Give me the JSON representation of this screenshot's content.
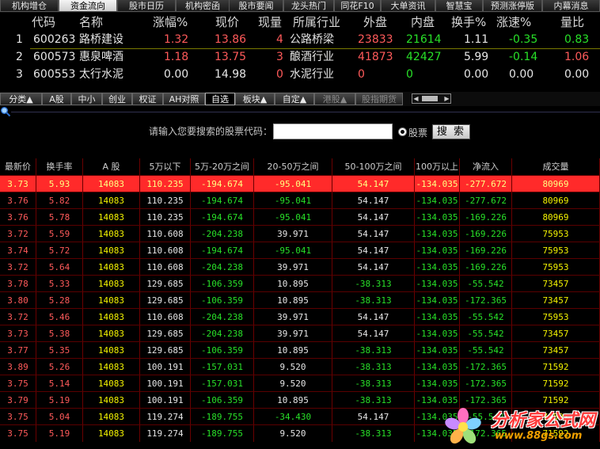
{
  "top_tabs": [
    "机构增仓",
    "资金流向",
    "股市日历",
    "机构密函",
    "股市要闻",
    "龙头热门",
    "同花F10",
    "大单资讯",
    "智慧宝",
    "预测涨停版",
    "内幕消息"
  ],
  "top_tabs_active": 1,
  "quote": {
    "headers": [
      "代码",
      "名称",
      "涨幅%",
      "现价",
      "现量",
      "所属行业",
      "外盘",
      "内盘",
      "换手%",
      "涨速%",
      "量比"
    ],
    "rows": [
      {
        "idx": "1",
        "code": "600263",
        "name": "路桥建设",
        "chg": "1.32",
        "price": "13.86",
        "vol": "4",
        "industry": "公路桥梁",
        "outer": "23833",
        "inner": "21614",
        "turn": "1.11",
        "speed": "-0.35",
        "ratio": "0.83"
      },
      {
        "idx": "2",
        "code": "600573",
        "name": "惠泉啤酒",
        "chg": "1.18",
        "price": "13.75",
        "vol": "3",
        "industry": "酿酒行业",
        "outer": "41873",
        "inner": "42427",
        "turn": "5.99",
        "speed": "-0.14",
        "ratio": "1.06"
      },
      {
        "idx": "3",
        "code": "600553",
        "name": "太行水泥",
        "chg": "0.00",
        "price": "14.98",
        "vol": "0",
        "industry": "水泥行业",
        "outer": "0",
        "inner": "0",
        "turn": "0.00",
        "speed": "0.00",
        "ratio": "0.00"
      }
    ]
  },
  "board_tabs": [
    "分类▲",
    "A股",
    "中小",
    "创业",
    "权证",
    "AH对照",
    "自选",
    "板块▲",
    "自定▲",
    "港股▲",
    "股指期货"
  ],
  "board_tabs_active": 6,
  "search": {
    "prompt": "请输入您要搜索的股票代码：",
    "value": "",
    "radio_label": "股票",
    "button": "搜 索"
  },
  "table": {
    "headers": [
      "最新价",
      "换手率",
      "A 股",
      "5万以下",
      "5万-20万之间",
      "20-50万之间",
      "50-100万之间",
      "100万以上",
      "净流入",
      "成交量"
    ],
    "rows": [
      [
        "3.73",
        "5.93",
        "14083",
        "110.235",
        "-194.674",
        "-95.041",
        "54.147",
        "-134.035",
        "-277.672",
        "80969"
      ],
      [
        "3.76",
        "5.82",
        "14083",
        "110.235",
        "-194.674",
        "-95.041",
        "54.147",
        "-134.035",
        "-277.672",
        "80969"
      ],
      [
        "3.76",
        "5.78",
        "14083",
        "110.235",
        "-194.674",
        "-95.041",
        "54.147",
        "-134.035",
        "-169.226",
        "80969"
      ],
      [
        "3.72",
        "5.59",
        "14083",
        "110.608",
        "-204.238",
        "39.971",
        "54.147",
        "-134.035",
        "-169.226",
        "75953"
      ],
      [
        "3.74",
        "5.72",
        "14083",
        "110.608",
        "-194.674",
        "-95.041",
        "54.147",
        "-134.035",
        "-169.226",
        "75953"
      ],
      [
        "3.72",
        "5.64",
        "14083",
        "110.608",
        "-204.238",
        "39.971",
        "54.147",
        "-134.035",
        "-169.226",
        "75953"
      ],
      [
        "3.78",
        "5.33",
        "14083",
        "129.685",
        "-106.359",
        "10.895",
        "-38.313",
        "-134.035",
        "-55.542",
        "73457"
      ],
      [
        "3.80",
        "5.28",
        "14083",
        "129.685",
        "-106.359",
        "10.895",
        "-38.313",
        "-134.035",
        "-172.365",
        "73457"
      ],
      [
        "3.72",
        "5.46",
        "14083",
        "110.608",
        "-204.238",
        "39.971",
        "54.147",
        "-134.035",
        "-55.542",
        "75953"
      ],
      [
        "3.73",
        "5.38",
        "14083",
        "129.685",
        "-204.238",
        "39.971",
        "54.147",
        "-134.035",
        "-55.542",
        "73457"
      ],
      [
        "3.77",
        "5.35",
        "14083",
        "129.685",
        "-106.359",
        "10.895",
        "-38.313",
        "-134.035",
        "-55.542",
        "73457"
      ],
      [
        "3.89",
        "5.26",
        "14083",
        "100.191",
        "-157.031",
        "9.520",
        "-38.313",
        "-134.035",
        "-172.365",
        "71592"
      ],
      [
        "3.75",
        "5.14",
        "14083",
        "100.191",
        "-157.031",
        "9.520",
        "-38.313",
        "-134.035",
        "-172.365",
        "71592"
      ],
      [
        "3.79",
        "5.19",
        "14083",
        "100.191",
        "-106.359",
        "10.895",
        "-38.313",
        "-134.035",
        "-172.365",
        "71592"
      ],
      [
        "3.75",
        "5.04",
        "14083",
        "119.274",
        "-189.755",
        "-34.430",
        "54.147",
        "-134.035",
        "-55.542",
        "71592"
      ],
      [
        "3.75",
        "5.19",
        "14083",
        "119.274",
        "-189.755",
        "9.520",
        "-38.313",
        "-134.035",
        "-172.365",
        "71592"
      ]
    ]
  },
  "watermark": {
    "title": "分析家公式网",
    "url": "www.88gs.com"
  },
  "colors": {
    "up": "#ff5a5a",
    "down": "#28e028",
    "selected_row": "#ff2a2a",
    "accent_yellow": "#f2f200",
    "grid_line": "#6a0000"
  }
}
